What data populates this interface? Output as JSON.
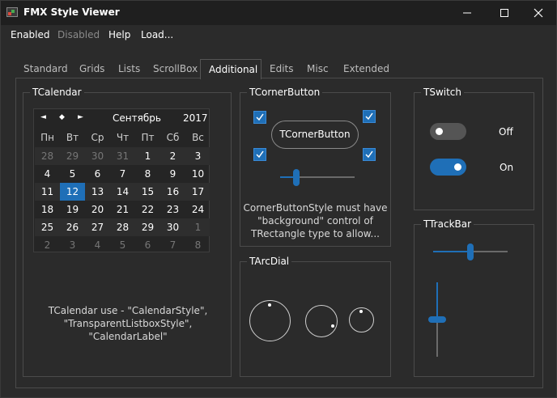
{
  "window": {
    "title": "FMX Style Viewer"
  },
  "menu": [
    "Enabled",
    "Disabled",
    "Help",
    "Load..."
  ],
  "tabs": [
    "Standard",
    "Grids",
    "Lists",
    "ScrollBox",
    "Additional",
    "Edits",
    "Misc",
    "Extended"
  ],
  "active_tab": "Additional",
  "calendar_group": {
    "title": "TCalendar",
    "nav": [
      "◄",
      "◆",
      "►"
    ],
    "month": "Сентябрь",
    "year": "2017",
    "weekdays": [
      "Пн",
      "Вт",
      "Ср",
      "Чт",
      "Пт",
      "Сб",
      "Вс"
    ],
    "weeks": [
      [
        "28",
        "29",
        "30",
        "31",
        "1",
        "2",
        "3"
      ],
      [
        "4",
        "5",
        "6",
        "7",
        "8",
        "9",
        "10"
      ],
      [
        "11",
        "12",
        "13",
        "14",
        "15",
        "16",
        "17"
      ],
      [
        "18",
        "19",
        "20",
        "21",
        "22",
        "23",
        "24"
      ],
      [
        "25",
        "26",
        "27",
        "28",
        "29",
        "30",
        "1"
      ],
      [
        "2",
        "3",
        "4",
        "5",
        "6",
        "7",
        "8"
      ]
    ],
    "selected": "12",
    "caption_line1": "TCalendar use - \"CalendarStyle\",",
    "caption_line2": "\"TransparentListboxStyle\", \"CalendarLabel\""
  },
  "corner_group": {
    "title": "TCornerButton",
    "button_label": "TCornerButton",
    "slider_value": 0.22,
    "note_line1": "CornerButtonStyle must have",
    "note_line2": "\"background\" control of",
    "note_line3": "TRectangle type to allow..."
  },
  "switch_group": {
    "title": "TSwitch",
    "off_label": "Off",
    "on_label": "On"
  },
  "arcdial_group": {
    "title": "TArcDial"
  },
  "trackbar_group": {
    "title": "TTrackBar",
    "horizontal_value": 0.5,
    "vertical_value": 0.5
  },
  "colors": {
    "accent": "#1f6fb7",
    "background": "#2b2b2b",
    "titlebar": "#1f1f1f"
  }
}
